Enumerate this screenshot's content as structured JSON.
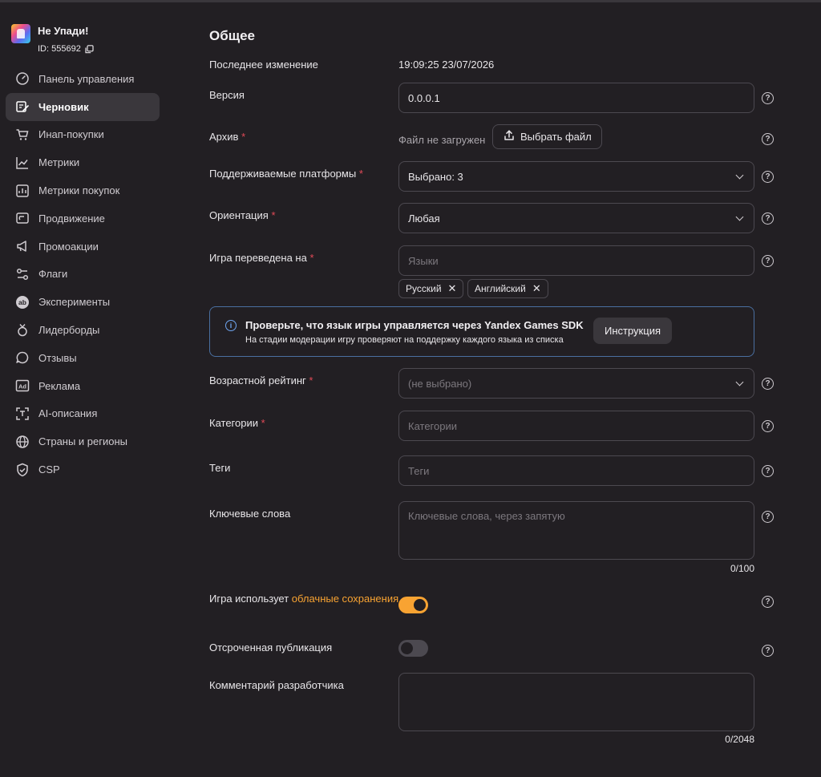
{
  "app": {
    "title": "Не Упади!",
    "id": "ID: 555692"
  },
  "sidebar": {
    "items": [
      {
        "label": "Панель управления",
        "icon": "dashboard-icon"
      },
      {
        "label": "Черновик",
        "icon": "edit-icon",
        "active": true
      },
      {
        "label": "Инап-покупки",
        "icon": "cart-icon"
      },
      {
        "label": "Метрики",
        "icon": "chart-icon"
      },
      {
        "label": "Метрики покупок",
        "icon": "purchase-metrics-icon"
      },
      {
        "label": "Продвижение",
        "icon": "promotion-icon"
      },
      {
        "label": "Промоакции",
        "icon": "megaphone-icon"
      },
      {
        "label": "Флаги",
        "icon": "flags-icon"
      },
      {
        "label": "Эксперименты",
        "icon": "ab-icon"
      },
      {
        "label": "Лидерборды",
        "icon": "leaderboard-icon"
      },
      {
        "label": "Отзывы",
        "icon": "reviews-icon"
      },
      {
        "label": "Реклама",
        "icon": "ad-icon"
      },
      {
        "label": "AI-описания",
        "icon": "ai-icon"
      },
      {
        "label": "Страны и регионы",
        "icon": "globe-icon"
      },
      {
        "label": "CSP",
        "icon": "shield-icon"
      }
    ]
  },
  "main": {
    "section_title": "Общее",
    "last_modified": {
      "label": "Последнее изменение",
      "value": "19:09:25 23/07/2026"
    },
    "version": {
      "label": "Версия",
      "value": "0.0.0.1"
    },
    "archive": {
      "label": "Архив",
      "status": "Файл не загружен",
      "button": "Выбрать файл"
    },
    "platforms": {
      "label": "Поддерживаемые платформы",
      "value": "Выбрано: 3"
    },
    "orientation": {
      "label": "Ориентация",
      "value": "Любая"
    },
    "languages": {
      "label": "Игра переведена на",
      "placeholder": "Языки",
      "chips": [
        "Русский",
        "Английский"
      ]
    },
    "banner": {
      "title": "Проверьте, что язык игры управляется через Yandex Games SDK",
      "text": "На стадии модерации игру проверяют на поддержку каждого языка из списка",
      "button": "Инструкция"
    },
    "age_rating": {
      "label": "Возрастной рейтинг",
      "value": "(не выбрано)"
    },
    "categories": {
      "label": "Категории",
      "placeholder": "Категории"
    },
    "tags": {
      "label": "Теги",
      "placeholder": "Теги"
    },
    "keywords": {
      "label": "Ключевые слова",
      "placeholder": "Ключевые слова, через запятую",
      "counter": "0/100"
    },
    "cloud_saves": {
      "label_prefix": "Игра использует ",
      "label_link": "облачные сохранения",
      "enabled": true
    },
    "deferred": {
      "label": "Отсроченная публикация",
      "enabled": false
    },
    "dev_comment": {
      "label": "Комментарий разработчика",
      "counter": "0/2048"
    },
    "required_mark": "*",
    "help_glyph": "?",
    "info_glyph": "i",
    "chip_remove_glyph": "✕"
  },
  "colors": {
    "background": "#221f23",
    "accent": "#f8a332",
    "required": "#e24a57",
    "info_border": "#4a6fa0"
  }
}
